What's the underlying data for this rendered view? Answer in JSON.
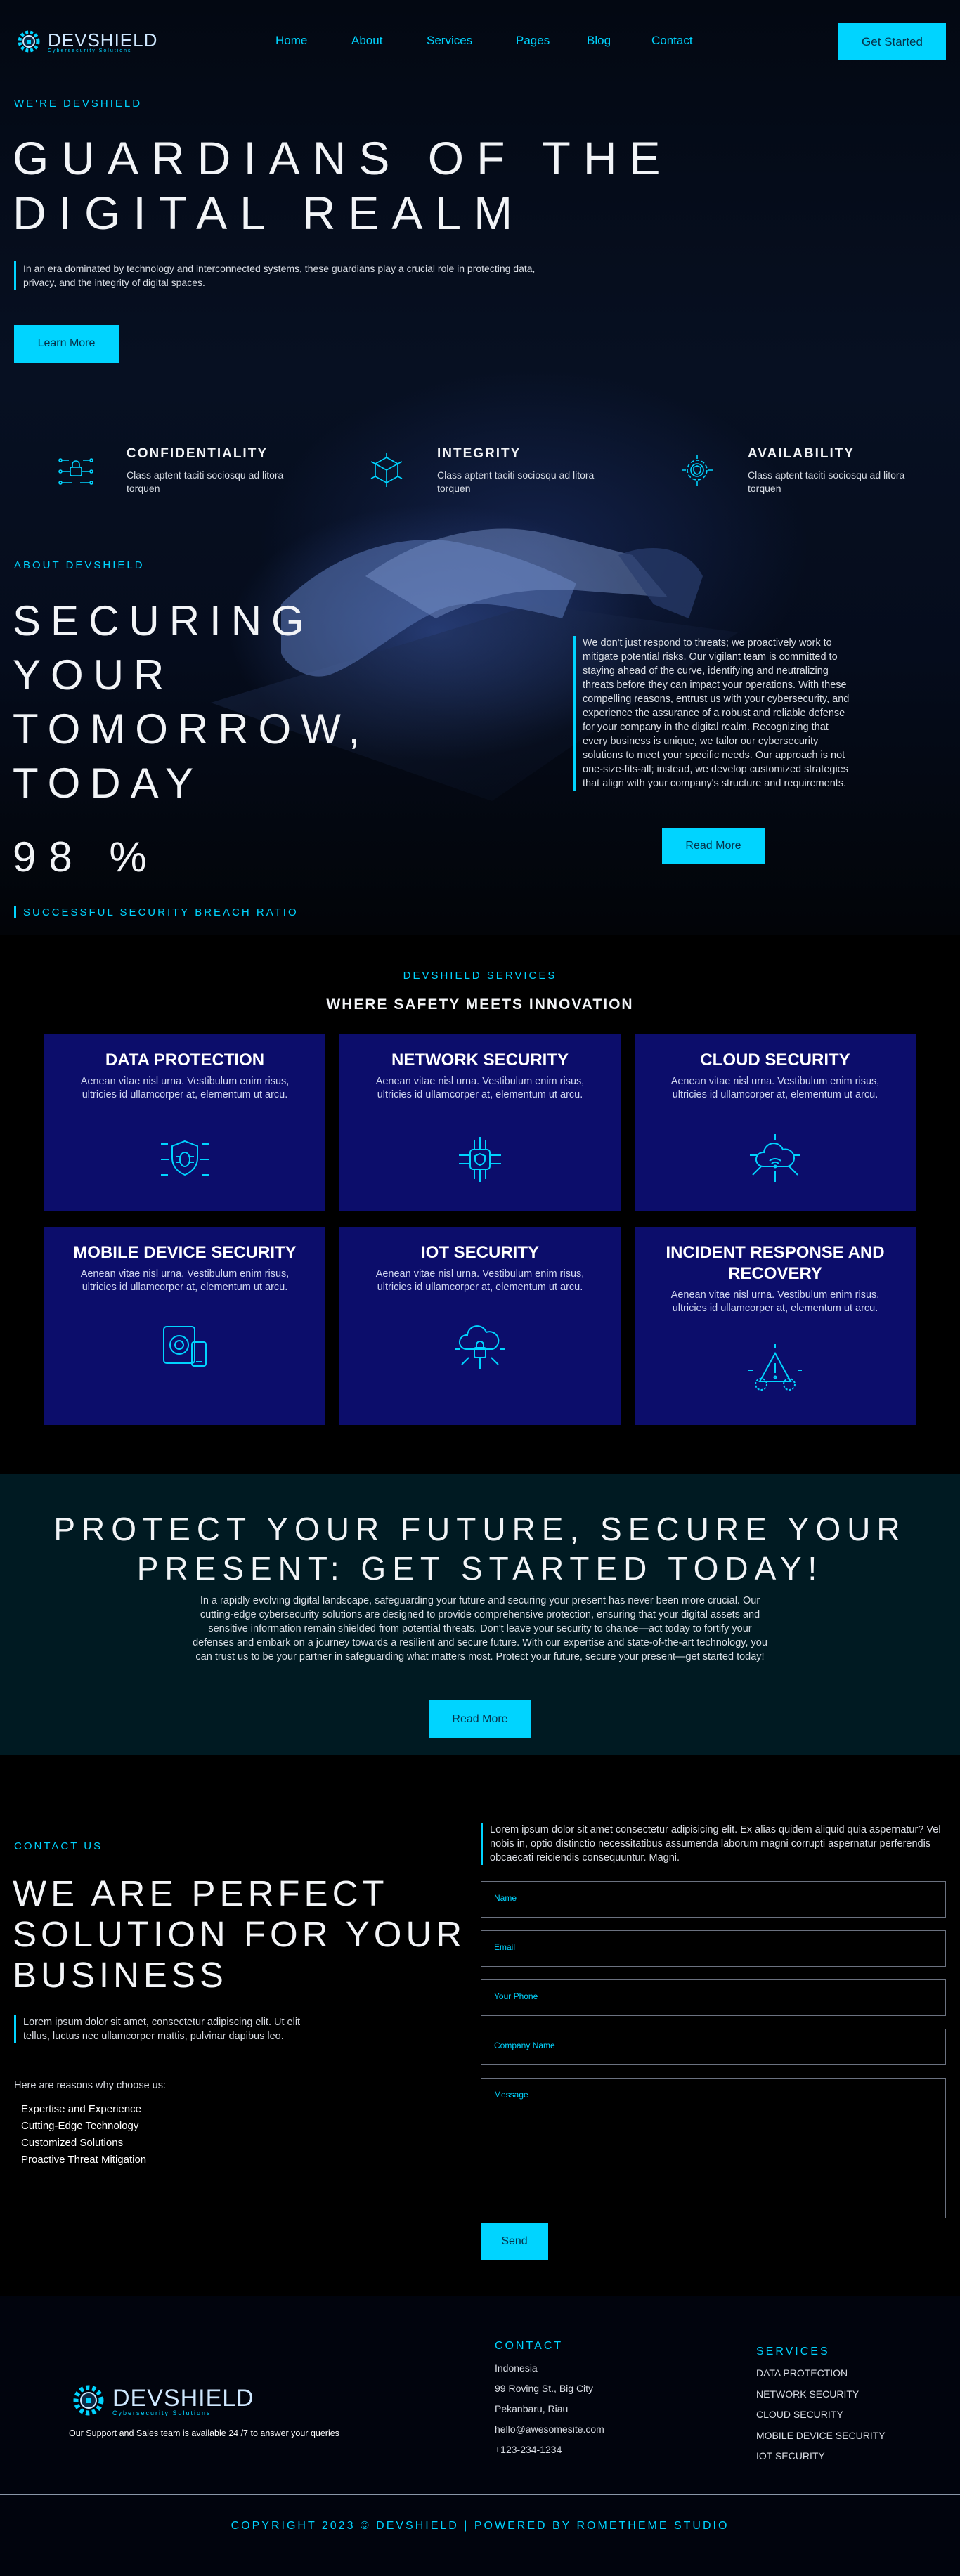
{
  "brand": {
    "name": "DEVSHIELD",
    "tagline": "Cybersecurity Solutions"
  },
  "nav": {
    "links": [
      "Home",
      "About",
      "Services",
      "Pages",
      "Blog",
      "Contact"
    ],
    "cta": "Get Started"
  },
  "hero": {
    "eyebrow": "WE'RE DEVSHIELD",
    "title_line1": "GUARDIANS OF THE",
    "title_line2": "DIGITAL REALM",
    "description": "In an era dominated by technology and interconnected systems, these guardians play a crucial role in protecting data, privacy, and the integrity of digital spaces.",
    "button": "Learn More"
  },
  "features": [
    {
      "title": "CONFIDENTIALITY",
      "text": "Class aptent taciti sociosqu ad litora torquen",
      "icon": "network-lock-icon"
    },
    {
      "title": "INTEGRITY",
      "text": "Class aptent taciti sociosqu ad litora torquen",
      "icon": "cube-chip-icon"
    },
    {
      "title": "AVAILABILITY",
      "text": "Class aptent taciti sociosqu ad litora torquen",
      "icon": "gear-shield-icon"
    }
  ],
  "about": {
    "eyebrow": "ABOUT DEVSHIELD",
    "title_lines": [
      "SECURING",
      "YOUR",
      "TOMORROW,",
      "TODAY"
    ],
    "stat": "98 %",
    "stat_label": "SUCCESSFUL SECURITY BREACH RATIO",
    "description": "We don't just respond to threats; we proactively work to mitigate potential risks. Our vigilant team is committed to staying ahead of the curve, identifying and neutralizing threats before they can impact your operations. With these compelling reasons, entrust us with your cybersecurity, and experience the assurance of a robust and reliable defense for your company in the digital realm. Recognizing that every business is unique, we tailor our cybersecurity solutions to meet your specific needs. Our approach is not one-size-fits-all; instead, we develop customized strategies that align with your company's structure and requirements.",
    "button": "Read More"
  },
  "services": {
    "eyebrow": "DEVSHIELD SERVICES",
    "title": "WHERE SAFETY MEETS INNOVATION",
    "cards": [
      {
        "title": "DATA PROTECTION",
        "text": "Aenean vitae nisl urna. Vestibulum enim risus, ultricies id ullamcorper at, elementum ut arcu.",
        "icon": "bug-shield-icon"
      },
      {
        "title": "NETWORK SECURITY",
        "text": "Aenean vitae nisl urna. Vestibulum enim risus, ultricies id ullamcorper at, elementum ut arcu.",
        "icon": "circuit-shield-icon"
      },
      {
        "title": "CLOUD SECURITY",
        "text": "Aenean vitae nisl urna. Vestibulum enim risus, ultricies id ullamcorper at, elementum ut arcu.",
        "icon": "cloud-wifi-icon"
      },
      {
        "title": "MOBILE DEVICE SECURITY",
        "text": "Aenean vitae nisl urna. Vestibulum enim risus, ultricies id ullamcorper at, elementum ut arcu.",
        "icon": "mobile-devices-icon"
      },
      {
        "title": "IOT SECURITY",
        "text": "Aenean vitae nisl urna. Vestibulum enim risus, ultricies id ullamcorper at, elementum ut arcu.",
        "icon": "cloud-lock-icon"
      },
      {
        "title": "INCIDENT RESPONSE AND RECOVERY",
        "text": "Aenean vitae nisl urna. Vestibulum enim risus, ultricies id ullamcorper at, elementum ut arcu.",
        "icon": "alert-gear-icon"
      }
    ]
  },
  "cta": {
    "title_line1": "PROTECT YOUR FUTURE, SECURE YOUR",
    "title_line2": "PRESENT: GET STARTED TODAY!",
    "description": "In a rapidly evolving digital landscape, safeguarding your future and securing your present has never been more crucial. Our cutting-edge cybersecurity solutions are designed to provide comprehensive protection, ensuring that your digital assets and sensitive information remain shielded from potential threats. Don't leave your security to chance—act today to fortify your defenses and embark on a journey towards a resilient and secure future. With our expertise and state-of-the-art technology, you can trust us to be your partner in safeguarding what matters most. Protect your future, secure your present—get started today!",
    "button": "Read More"
  },
  "contact": {
    "eyebrow": "CONTACT US",
    "title_lines": [
      "WE ARE PERFECT",
      "SOLUTION FOR YOUR",
      "BUSINESS"
    ],
    "description": "Lorem ipsum dolor sit amet, consectetur adipiscing elit. Ut elit tellus, luctus nec ullamcorper mattis, pulvinar dapibus leo.",
    "reasons_label": "Here are reasons why choose us:",
    "reasons": [
      "Expertise and Experience",
      "Cutting-Edge Technology",
      "Customized Solutions",
      "Proactive Threat Mitigation"
    ],
    "right_description": "Lorem ipsum dolor sit amet consectetur adipisicing elit. Ex alias quidem aliquid quia aspernatur? Vel nobis in, optio distinctio necessitatibus assumenda laborum magni corrupti aspernatur perferendis obcaecati reiciendis consequuntur. Magni.",
    "form": {
      "name": "Name",
      "email": "Email",
      "phone": "Your Phone",
      "company": "Company Name",
      "message": "Message",
      "submit": "Send"
    }
  },
  "footer": {
    "support": "Our Support and Sales team is available 24 /7 to answer your queries",
    "contact_title": "CONTACT",
    "contact_lines": [
      "Indonesia",
      "99 Roving St., Big City",
      "Pekanbaru, Riau",
      "hello@awesomesite.com",
      "+123-234-1234"
    ],
    "services_title": "SERVICES",
    "services": [
      "DATA PROTECTION",
      "NETWORK SECURITY",
      "CLOUD SECURITY",
      "MOBILE DEVICE SECURITY",
      "IOT SECURITY"
    ],
    "copyright": "COPYRIGHT 2023 © DEVSHIELD | POWERED BY ROMETHEME STUDIO"
  },
  "colors": {
    "accent": "#00d4ff",
    "card": "#0c0d6b",
    "cta_bg": "#001a22"
  }
}
